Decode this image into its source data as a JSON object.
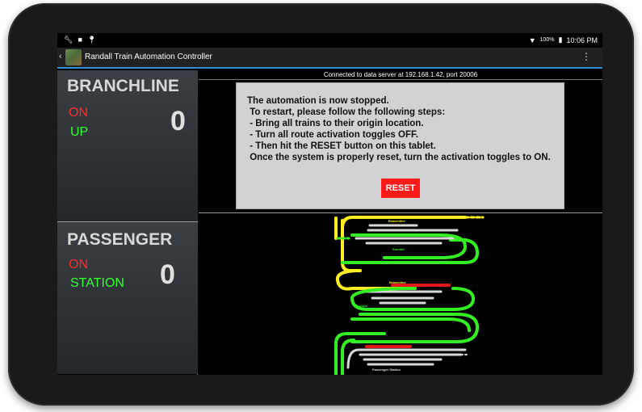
{
  "status_bar": {
    "left_icons": [
      "wrench-icon",
      "square-icon",
      "pin-icon"
    ],
    "battery": "100%",
    "time": "10:06 PM"
  },
  "app": {
    "title": "Randall Train Automation Controller"
  },
  "routes": [
    {
      "name": "BRANCHLINE",
      "status": "ON",
      "state": "UP",
      "count": "0"
    },
    {
      "name": "PASSENGER",
      "status": "ON",
      "state": "STATION",
      "count": "0"
    }
  ],
  "connection": "Connected to data server at 192.168.1.42, port 20006",
  "dialog": {
    "message": "The automation is now stopped.\n To restart, please follow the following steps:\n - Bring all trains to their origin location.\n - Turn all route activation toggles OFF.\n - Then hit the RESET button on this tablet.\n Once the system is properly reset, turn the activation toggles to ON.",
    "reset_label": "RESET"
  },
  "track_map": {
    "labels": {
      "branchline_top": "Branchline",
      "summit": "Summit",
      "branchline_mid": "Branchline",
      "sonora": "Sonora",
      "passenger_station": "Passenger Station"
    }
  },
  "colors": {
    "status_on": "#ff2a2a",
    "state": "#33ff33",
    "reset": "#ff1a1a",
    "accent": "#2f8fd3",
    "track_yellow": "#ffee22",
    "track_green": "#33ee22",
    "track_red": "#e01818",
    "track_white": "#d8d8d8"
  }
}
